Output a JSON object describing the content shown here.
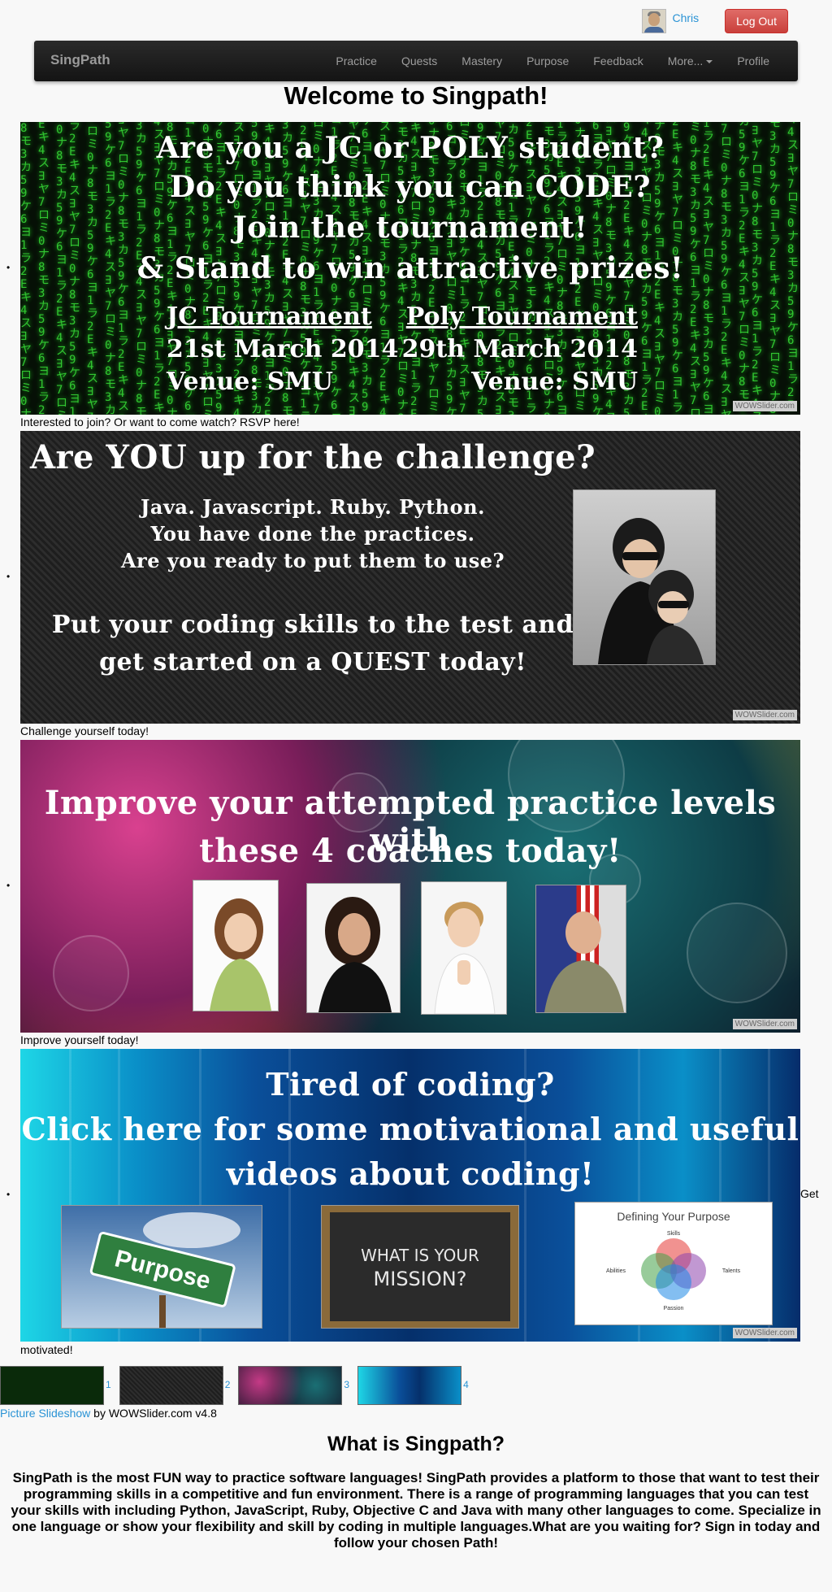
{
  "user": {
    "name": "Chris",
    "logout_label": "Log Out"
  },
  "nav": {
    "brand": "SingPath",
    "items": [
      "Practice",
      "Quests",
      "Mastery",
      "Purpose",
      "Feedback",
      "More...",
      "Profile"
    ]
  },
  "welcome_title": "Welcome to Singpath!",
  "bullet": "•",
  "slides": [
    {
      "lines": [
        "Are you a JC or POLY student?",
        "Do you think you can CODE?",
        "Join the tournament!",
        "& Stand to win attractive prizes!"
      ],
      "left_event": {
        "title": "JC Tournament",
        "date": "21st March 2014",
        "venue": "Venue: SMU"
      },
      "right_event": {
        "title": "Poly Tournament",
        "date": "29th March 2014",
        "venue": "Venue: SMU"
      },
      "watermark": "WOWSlider.com",
      "caption": "Interested to join? Or want to come watch? RSVP here!"
    },
    {
      "lines": [
        "Are YOU up for the challenge?",
        "Java. Javascript. Ruby. Python.",
        "You have done the practices.",
        "Are you ready to put them to use?",
        "Put your coding skills to the test and",
        "get started on  a QUEST today!"
      ],
      "watermark": "WOWSlider.com",
      "caption": "Challenge yourself today!"
    },
    {
      "lines": [
        "Improve your attempted practice levels with",
        "these 4 coaches today!"
      ],
      "watermark": "WOWSlider.com",
      "caption": "Improve yourself today!"
    },
    {
      "lines": [
        "Tired of coding?",
        "Click here for some motivational and useful",
        "videos about coding!"
      ],
      "sign_text": "Purpose",
      "board_text": [
        "WHAT IS YOUR",
        "MISSION?"
      ],
      "diagram": {
        "title": "Defining Your Purpose",
        "labels": [
          "Skills",
          "Abilities",
          "Talents",
          "Passion"
        ]
      },
      "watermark": "WOWSlider.com",
      "caption_a": "Get",
      "caption_b": "motivated!"
    }
  ],
  "thumb_numbers": [
    "1",
    "2",
    "3",
    "4"
  ],
  "credit": {
    "link_text": "Picture Slideshow",
    "rest": " by WOWSlider.com v4.8"
  },
  "about": {
    "title": "What is Singpath?",
    "text": "SingPath is the most FUN way to practice software languages! SingPath provides a platform to those that want to test their programming skills in a competitive and fun environment. There is a range of programming languages that you can test your skills with including Python, JavaScript, Ruby, Objective C and Java with many other languages to come. Specialize in one language or show your flexibility and skill by coding in multiple languages.What are you waiting for? Sign in today and follow your chosen Path!"
  },
  "colors": {
    "navbar": "#1b1b1b",
    "logout": "#d9534f",
    "link": "#2a93d5"
  }
}
